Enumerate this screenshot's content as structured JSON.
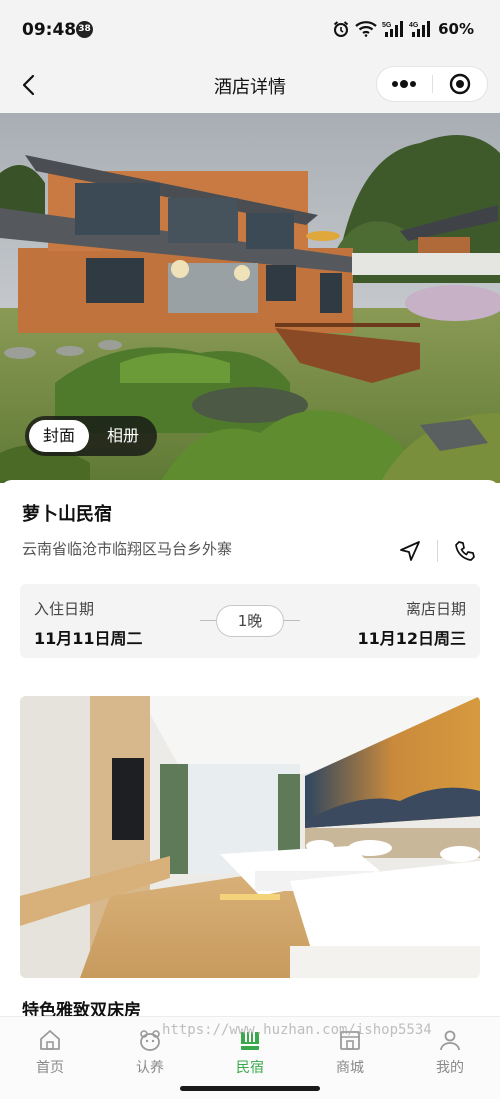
{
  "status_bar": {
    "time": "09:48",
    "badge": "38",
    "battery": "60%",
    "icons": [
      "alarm-icon",
      "wifi-icon",
      "5g-signal-icon",
      "4g-signal-icon"
    ]
  },
  "nav": {
    "title": "酒店详情",
    "back_icon": "back-arrow-icon",
    "capsule_icons": [
      "more-icon",
      "close-miniprogram-icon"
    ]
  },
  "hero": {
    "tabs": [
      {
        "label": "封面",
        "active": true
      },
      {
        "label": "相册",
        "active": false
      }
    ]
  },
  "hotel": {
    "name": "萝卜山民宿",
    "address": "云南省临沧市临翔区马台乡外寨",
    "actions": [
      "navigate-icon",
      "phone-icon"
    ]
  },
  "booking": {
    "checkin_label": "入住日期",
    "checkin_value": "11月11日周二",
    "nights": "1晚",
    "checkout_label": "离店日期",
    "checkout_value": "11月12日周三"
  },
  "room": {
    "name": "特色雅致双床房"
  },
  "tab_bar": {
    "items": [
      {
        "label": "首页",
        "icon": "home-icon",
        "active": false
      },
      {
        "label": "认养",
        "icon": "adopt-icon",
        "active": false
      },
      {
        "label": "民宿",
        "icon": "homestay-icon",
        "active": true
      },
      {
        "label": "商城",
        "icon": "mall-icon",
        "active": false
      },
      {
        "label": "我的",
        "icon": "profile-icon",
        "active": false
      }
    ]
  },
  "watermark": "https://www.huzhan.com/ishop5534",
  "colors": {
    "accent": "#3aa94c",
    "bar_background": "#f3f3f3"
  }
}
